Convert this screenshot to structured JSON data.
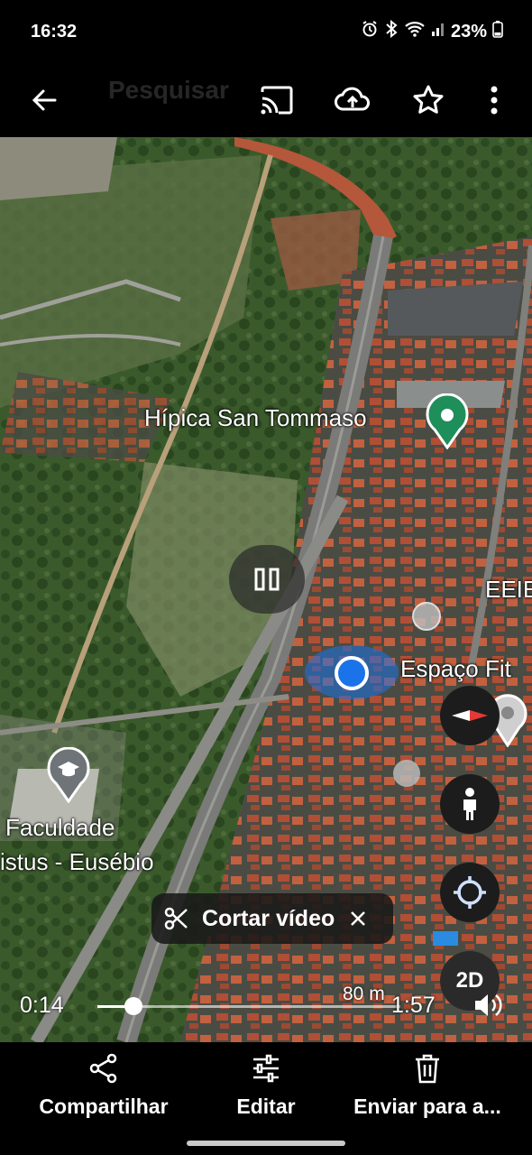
{
  "status_bar": {
    "time": "16:32",
    "battery": "23%"
  },
  "toolbar": {
    "behind_search_text": "Pesquisar"
  },
  "map": {
    "labels": {
      "hipica": "Hípica San Tommaso",
      "eeie": "EEIE",
      "espaco": "Espaço Fit",
      "faculdade_line1": "Faculdade",
      "faculdade_line2": "istus - Eusébio"
    },
    "scale": "80 m",
    "mode_2d": "2D"
  },
  "video": {
    "cut_label": "Cortar vídeo",
    "current_time": "0:14",
    "total_time": "1:57",
    "progress": 0.12
  },
  "bottom_bar": {
    "share_label": "Compartilhar",
    "edit_label": "Editar",
    "send_label": "Enviar para a..."
  },
  "colors": {
    "pin_green": "#1e8e5a",
    "location_blue": "#1a73e8",
    "compass_red": "#e53935"
  }
}
